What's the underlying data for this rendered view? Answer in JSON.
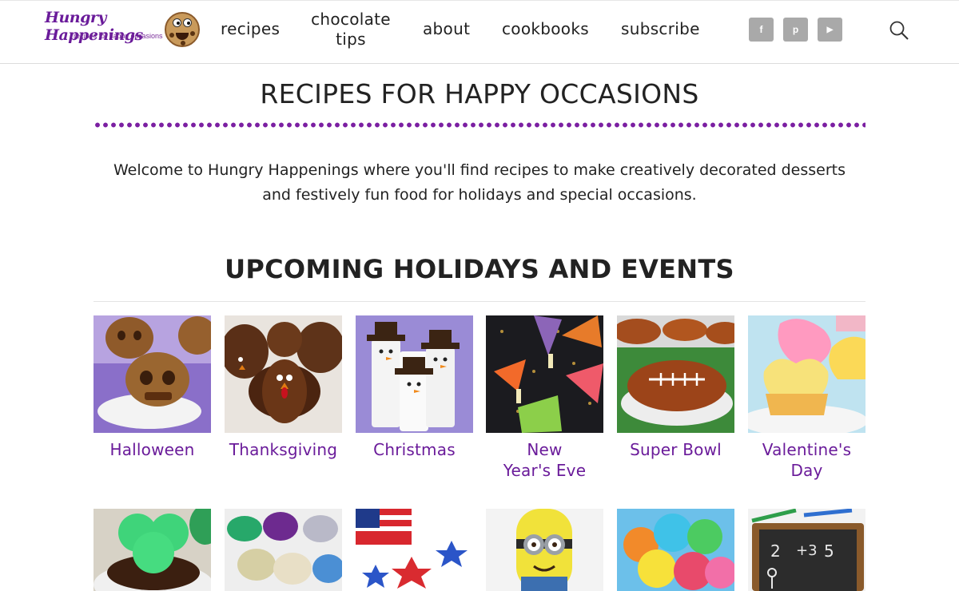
{
  "site": {
    "logo_title": "Hungry Happenings",
    "logo_tagline": "recipes for happy occasions",
    "brand_color": "#6a1b9a"
  },
  "nav": {
    "recipes": "recipes",
    "chocolate_tips_line1": "chocolate",
    "chocolate_tips_line2": "tips",
    "about": "about",
    "cookbooks": "cookbooks",
    "subscribe": "subscribe"
  },
  "social": {
    "facebook": "f",
    "pinterest": "p",
    "youtube": "▶"
  },
  "page": {
    "title": "RECIPES FOR HAPPY OCCASIONS",
    "intro_line1": "Welcome to Hungry Happenings where you'll find recipes to make creatively decorated desserts",
    "intro_line2": "and festively fun food for holidays and special occasions.",
    "section_heading": "UPCOMING HOLIDAYS AND EVENTS"
  },
  "events": [
    {
      "line1": "Halloween",
      "line2": ""
    },
    {
      "line1": "Thanksgiving",
      "line2": ""
    },
    {
      "line1": "Christmas",
      "line2": ""
    },
    {
      "line1": "New",
      "line2": "Year's Eve"
    },
    {
      "line1": "Super Bowl",
      "line2": ""
    },
    {
      "line1": "Valentine's",
      "line2": "Day"
    }
  ]
}
